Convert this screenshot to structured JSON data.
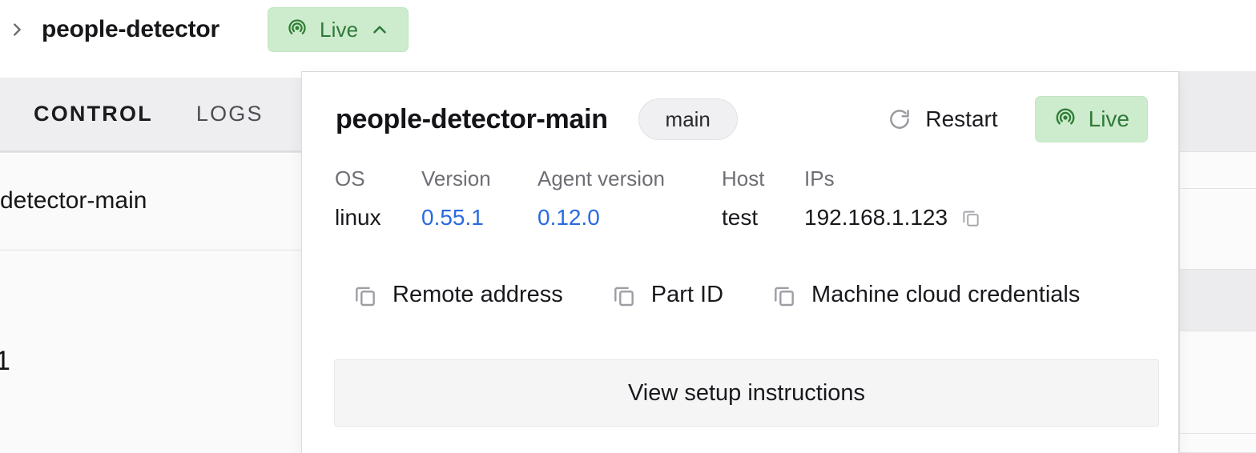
{
  "breadcrumb": {
    "chevron_icon": "chevron-right-icon",
    "title": "people-detector",
    "status": {
      "icon": "broadcast-live-icon",
      "label": "Live",
      "caret_icon": "chevron-up-icon"
    }
  },
  "background": {
    "tabs": [
      {
        "label": "CONTROL",
        "active": true
      },
      {
        "label": "LOGS",
        "active": false
      }
    ],
    "row_text": "detector-main",
    "clipped_text": "1"
  },
  "popover": {
    "title": "people-detector-main",
    "branch_badge": "main",
    "restart": {
      "icon": "refresh-icon",
      "label": "Restart"
    },
    "live": {
      "icon": "broadcast-live-icon",
      "label": "Live"
    },
    "meta": [
      {
        "label": "OS",
        "value": "linux",
        "link": false,
        "copy": false
      },
      {
        "label": "Version",
        "value": "0.55.1",
        "link": true,
        "copy": false
      },
      {
        "label": "Agent version",
        "value": "0.12.0",
        "link": true,
        "copy": false
      },
      {
        "label": "Host",
        "value": "test",
        "link": false,
        "copy": false
      },
      {
        "label": "IPs",
        "value": "192.168.1.123",
        "link": false,
        "copy": true
      }
    ],
    "copy_actions": [
      {
        "icon": "copy-icon",
        "label": "Remote address"
      },
      {
        "icon": "copy-icon",
        "label": "Part ID"
      },
      {
        "icon": "copy-icon",
        "label": "Machine cloud credentials"
      }
    ],
    "setup_button": "View setup instructions"
  },
  "colors": {
    "live_bg": "#cdeccd",
    "live_text": "#31793a",
    "link": "#2a6ae0",
    "badge_bg": "#f0f0f2",
    "setup_bg": "#f5f5f6",
    "tabstrip_bg": "#eeeef0"
  }
}
